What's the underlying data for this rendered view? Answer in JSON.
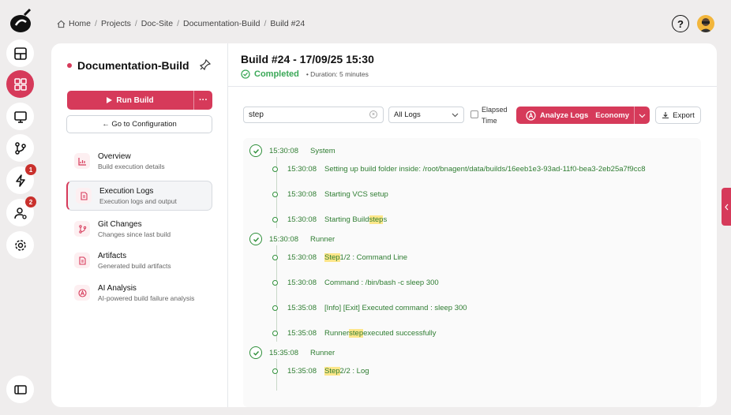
{
  "breadcrumb": [
    "Home",
    "Projects",
    "Doc-Site",
    "Documentation-Build",
    "Build #24"
  ],
  "sidebar": {
    "project_name": "Documentation-Build",
    "run_label": "Run Build",
    "more_label": "···",
    "config_label": "← Go to Configuration",
    "items": [
      {
        "title": "Overview",
        "subtitle": "Build execution details"
      },
      {
        "title": "Execution Logs",
        "subtitle": "Execution logs and output"
      },
      {
        "title": "Git Changes",
        "subtitle": "Changes since last build"
      },
      {
        "title": "Artifacts",
        "subtitle": "Generated build artifacts"
      },
      {
        "title": "AI Analysis",
        "subtitle": "AI-powered build failure analysis"
      }
    ]
  },
  "rail": {
    "badges": [
      "1",
      "2"
    ]
  },
  "header": {
    "title": "Build #24 - 17/09/25 15:30",
    "status": "Completed",
    "duration": "• Duration: 5 minutes"
  },
  "toolbar": {
    "search_value": "step",
    "log_filter": "All Logs",
    "elapsed_line1": "Elapsed",
    "elapsed_line2": "Time",
    "analyze_label": "Analyze Logs",
    "economy_label": "Economy",
    "export_label": "Export"
  },
  "logs": {
    "g1": {
      "time": "15:30:08",
      "name": "System"
    },
    "r1": {
      "time": "15:30:08",
      "text": "Setting up build folder inside: /root/bnagent/data/builds/16eeb1e3-93ad-11f0-bea3-2eb25a7f9cc8"
    },
    "r2": {
      "time": "15:30:08",
      "text": "Starting VCS setup"
    },
    "r3": {
      "time": "15:30:08",
      "pre": "Starting Build ",
      "hl": "step",
      "post": "s"
    },
    "g2": {
      "time": "15:30:08",
      "name": "Runner"
    },
    "r4": {
      "time": "15:30:08",
      "pre": "",
      "hl": "Step",
      "post": " 1/2 : Command Line"
    },
    "r5": {
      "time": "15:30:08",
      "text": "Command : /bin/bash -c sleep 300"
    },
    "r6": {
      "time": "15:35:08",
      "text": "[Info] [Exit] Executed command : sleep 300"
    },
    "r7": {
      "time": "15:35:08",
      "pre": "Runner ",
      "hl": "step",
      "post": " executed successfully"
    },
    "g3": {
      "time": "15:35:08",
      "name": "Runner"
    },
    "r8": {
      "time": "15:35:08",
      "pre": "",
      "hl": "Step",
      "post": " 2/2 : Log"
    }
  },
  "colors": {
    "accent": "#d63a5a",
    "success": "#2f7d32",
    "highlight": "#fde68a"
  }
}
